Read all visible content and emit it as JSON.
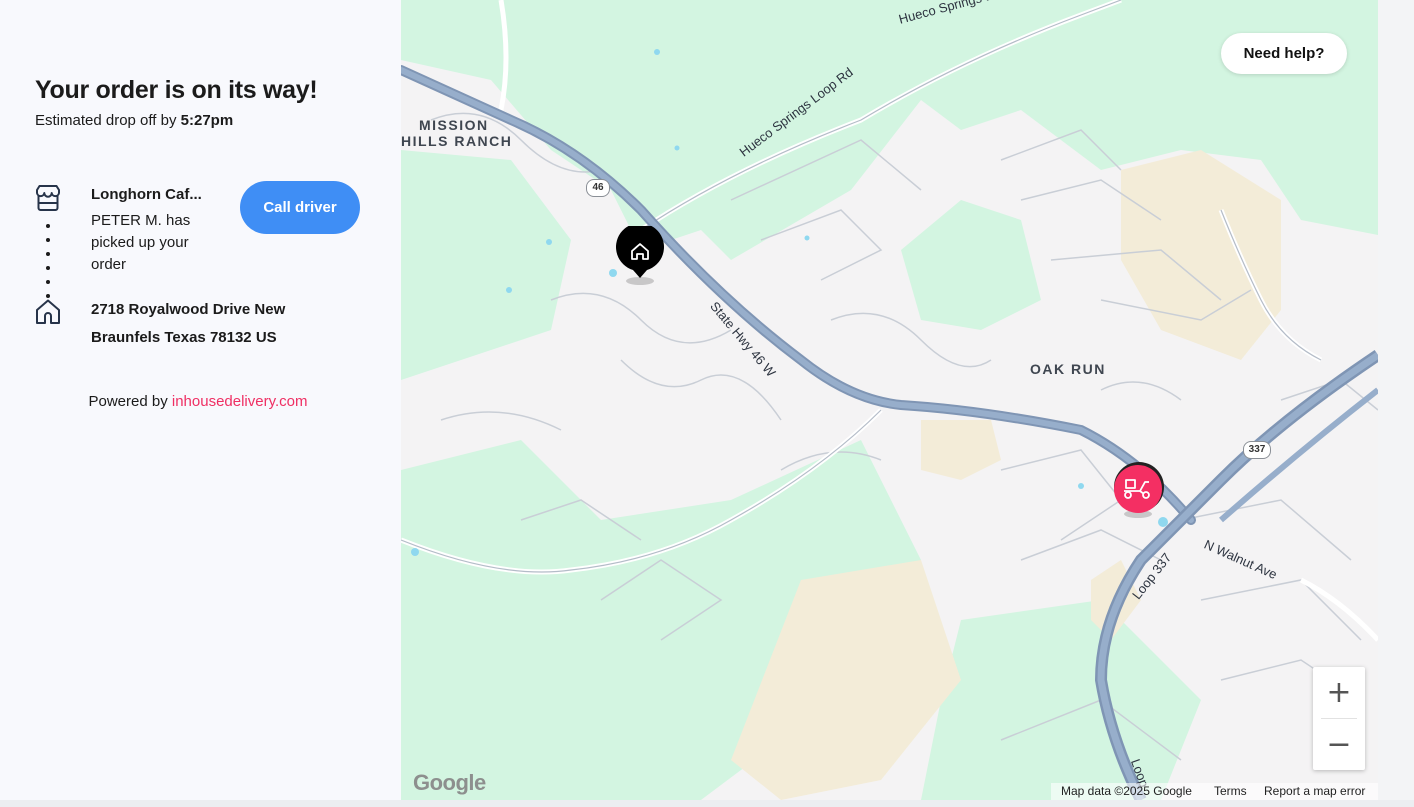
{
  "order": {
    "title": "Your order is on its way!",
    "eta_prefix": "Estimated drop off by",
    "eta_time": "5:27pm"
  },
  "pickup": {
    "store_name": "Longhorn Caf...",
    "status": "PETER M. has picked up your order",
    "icon": "storefront-icon"
  },
  "call_driver_label": "Call driver",
  "dropoff": {
    "address": "2718 Royalwood Drive New Braunfels Texas 78132 US",
    "icon": "home-icon"
  },
  "footer": {
    "powered_prefix": "Powered by",
    "powered_link": "inhousedelivery.com"
  },
  "map": {
    "help_label": "Need help?",
    "area_labels": {
      "mission_line1": "MISSION",
      "mission_line2": "HILLS RANCH",
      "oak_run": "OAK RUN"
    },
    "road_labels": {
      "hueco_top": "Hueco Springs Loop Rd",
      "hueco_mid": "Hueco Springs Loop Rd",
      "hwy46": "State Hwy 46 W",
      "walnut": "N Walnut Ave",
      "loop337": "Loop 337",
      "loop_bottom": "Loop"
    },
    "shields": {
      "s46": "46",
      "s337": "337"
    },
    "zoom_in": "+",
    "zoom_out": "−",
    "provider": "Google",
    "attribution": {
      "map_data": "Map data ©2025 Google",
      "terms": "Terms",
      "report": "Report a map error"
    },
    "colors": {
      "park": "#d3f5e1",
      "sand": "#f3ecd8",
      "highway": "#8fa7c6",
      "water": "#8fd8ef",
      "driver_pin": "#f42f63",
      "home_pin": "#000000"
    }
  },
  "accent_color": "#3f8ef5",
  "link_color": "#ef2f63"
}
